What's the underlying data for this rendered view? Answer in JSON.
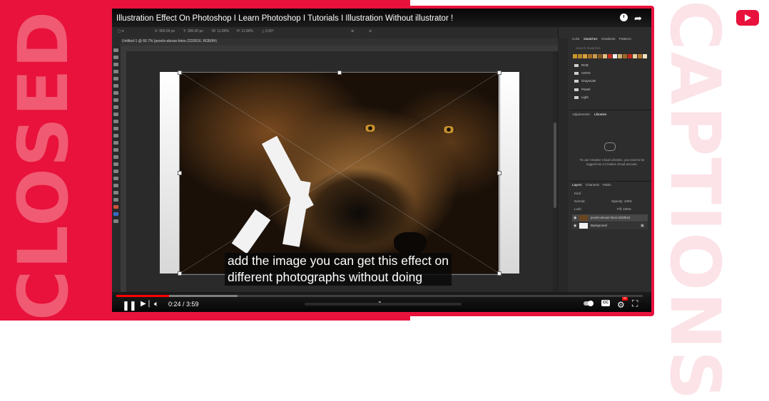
{
  "thumbnail": {
    "left_word": "CLOSED",
    "right_word": "CAPTIONS",
    "accent_color": "#e8123c"
  },
  "player": {
    "title": "Illustration Effect On Photoshop I Learn Photoshop I Tutorials I Illustration Without illustrator !",
    "time": "0:24 / 3:59",
    "progress": 0.1,
    "buffered": 0.23,
    "caption_line1": "add the image you can get this effect on",
    "caption_line2": "different photographs without doing",
    "icons": [
      "watch-later-icon",
      "share-icon",
      "play-pause-icon",
      "next-icon",
      "volume-icon",
      "autoplay-toggle-icon",
      "subtitles-icon",
      "settings-icon",
      "fullscreen-icon"
    ],
    "cc_label": "CC",
    "hd_label": "HD"
  },
  "photoshop": {
    "doc_tab": "Untitled-1 @ 66.7% (pexels-alexas-fotos-2220516, RGB/8#)",
    "panel_tabs": [
      "Color",
      "Swatches",
      "Gradients",
      "Patterns"
    ],
    "search_placeholder": "Search Swatches",
    "swatch_groups": [
      "RGB",
      "CMYK",
      "Grayscale",
      "Pastel",
      "Light"
    ],
    "lib_tabs": [
      "Adjustments",
      "Libraries"
    ],
    "cc_message": "To use Creative Cloud Libraries, you need to be logged into a Creative Cloud account.",
    "layer_tabs": [
      "Layers",
      "Channels",
      "Paths"
    ],
    "blend_mode": "Normal",
    "opacity_label": "Opacity: 100%",
    "fill_label": "Fill: 100%",
    "lock_label": "Lock:",
    "kind_label": "Kind",
    "layers": [
      {
        "name": "pexels-alexas-fotos-2220516",
        "selected": true
      },
      {
        "name": "Background",
        "selected": false
      }
    ]
  }
}
